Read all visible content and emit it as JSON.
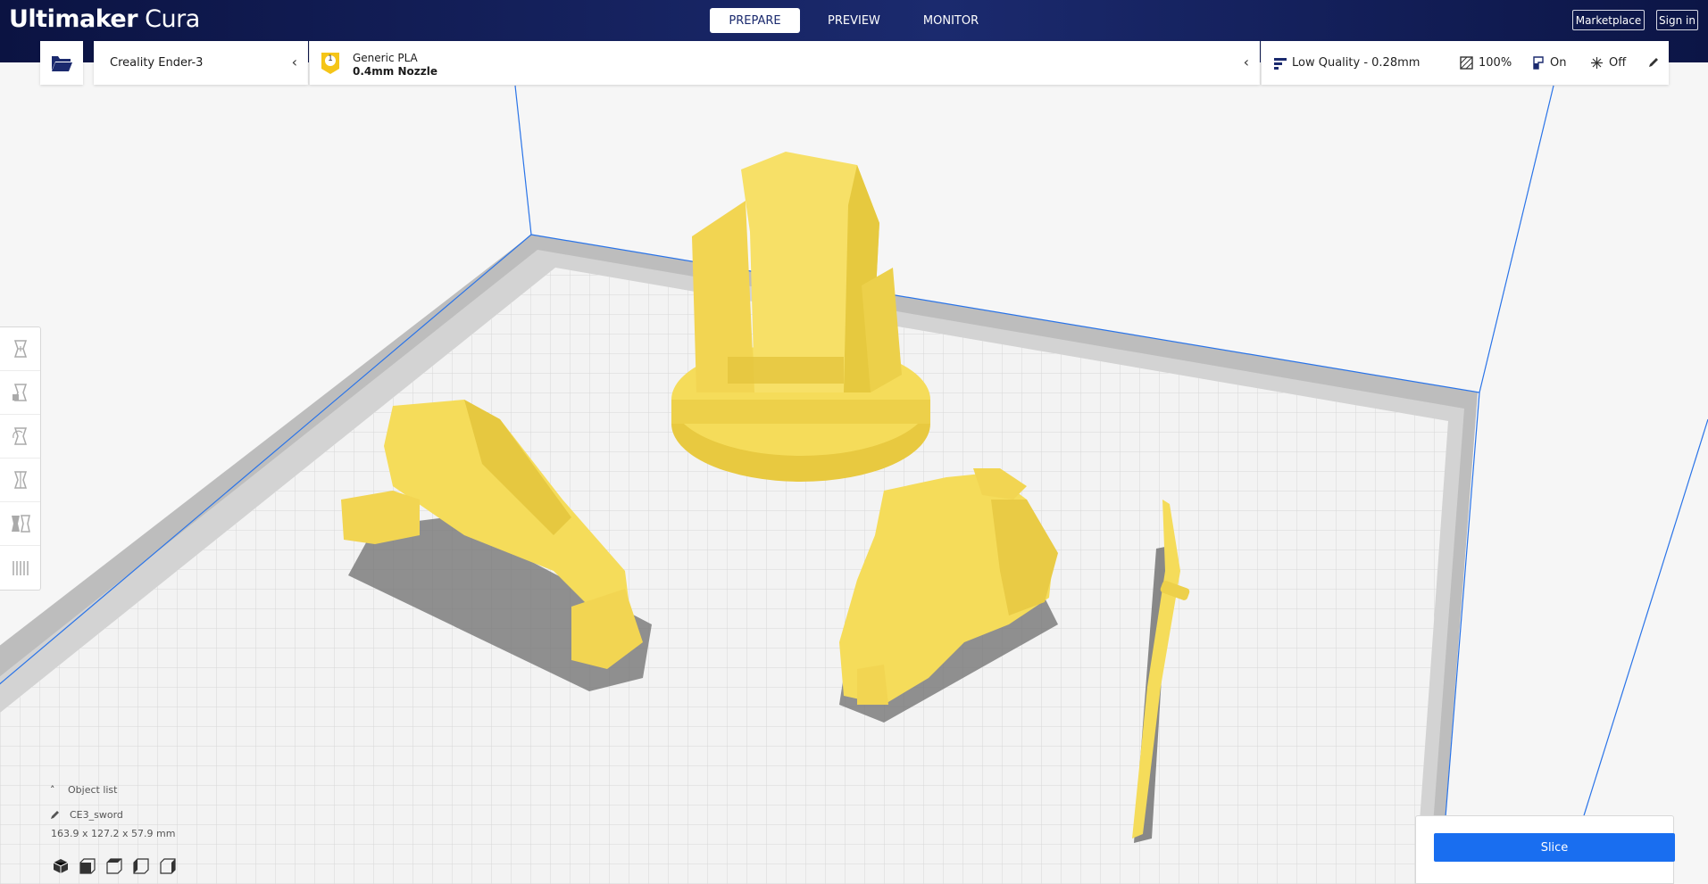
{
  "app": {
    "logo_bold": "Ultimaker",
    "logo_light": "Cura"
  },
  "header": {
    "stages": [
      {
        "label": "PREPARE",
        "active": true
      },
      {
        "label": "PREVIEW",
        "active": false
      },
      {
        "label": "MONITOR",
        "active": false
      }
    ],
    "marketplace_label": "Marketplace",
    "signin_label": "Sign in"
  },
  "printer": {
    "name": "Creality Ender-3"
  },
  "material": {
    "extruder_number": "1",
    "name": "Generic PLA",
    "nozzle": "0.4mm Nozzle"
  },
  "print_settings": {
    "profile": "Low Quality - 0.28mm",
    "infill": "100%",
    "support": "On",
    "adhesion": "Off"
  },
  "object_list": {
    "header": "Object list",
    "selected_object": "CE3_sword",
    "dimensions": "163.9 x 127.2 x 57.9 mm"
  },
  "slice": {
    "button_label": "Slice"
  },
  "colors": {
    "header_bg": "#0b1342",
    "accent_blue": "#196ef0",
    "model_yellow": "#f5dc5a",
    "build_plate": "#f4f4f4",
    "grid_line": "#d6d6d6",
    "border_gray": "#9b9b9b"
  }
}
